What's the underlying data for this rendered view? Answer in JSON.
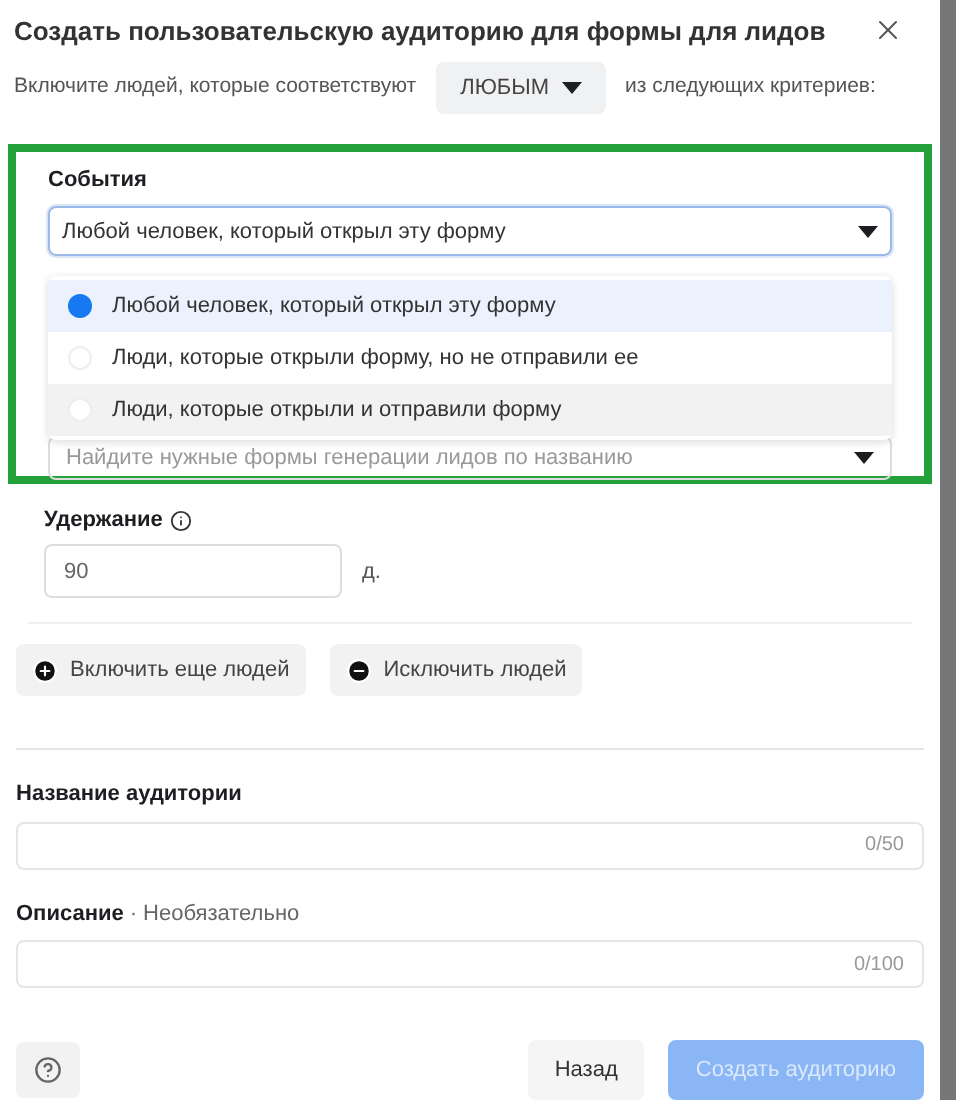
{
  "dialog": {
    "title": "Создать пользовательскую аудиторию для формы для лидов"
  },
  "criteria": {
    "before": "Включите людей, которые соответствуют",
    "match": "ЛЮБЫМ",
    "after": "из следующих критериев:"
  },
  "events": {
    "label": "События",
    "value": "Любой человек, который открыл эту форму",
    "highlighted": true,
    "options": [
      {
        "label": "Любой человек, который открыл эту форму",
        "selected": true,
        "hovered": false
      },
      {
        "label": "Люди, которые открыли форму, но не отправили ее",
        "selected": false,
        "hovered": false
      },
      {
        "label": "Люди, которые открыли и отправили форму",
        "selected": false,
        "hovered": true
      }
    ],
    "forms_field": {
      "placeholder": "Найдите нужные формы генерации лидов по названию"
    }
  },
  "retention": {
    "label": "Удержание",
    "value": "90",
    "unit": "д."
  },
  "actions": [
    {
      "kind": "include",
      "label": "Включить еще людей"
    },
    {
      "kind": "exclude",
      "label": "Исключить людей"
    }
  ],
  "audience_name": {
    "label": "Название аудитории",
    "counter": "0/50"
  },
  "description": {
    "label": "Описание",
    "separator": "·",
    "hint": "Необязательно",
    "counter": "0/100"
  },
  "footer": {
    "back": "Назад",
    "create": "Создать аудиторию",
    "create_disabled": true
  }
}
